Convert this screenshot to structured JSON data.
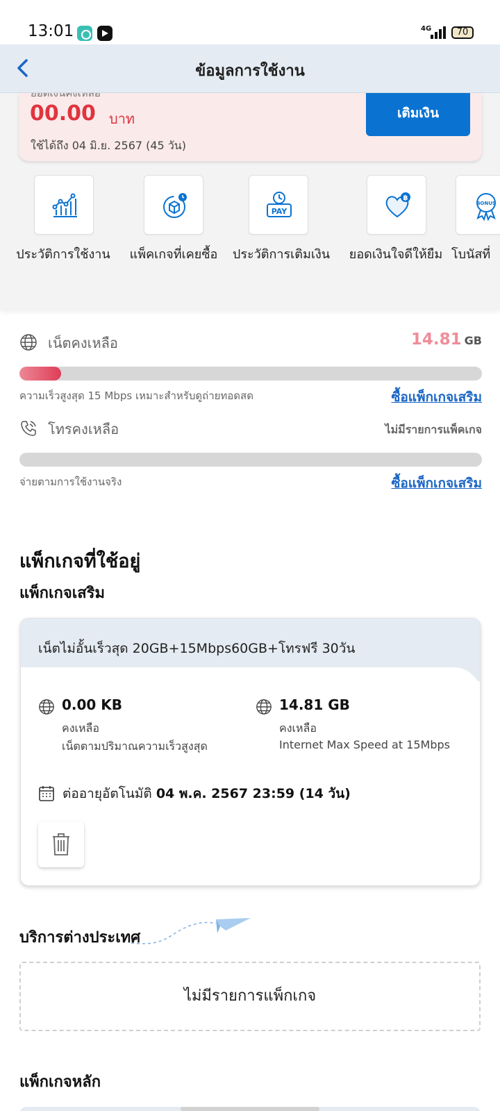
{
  "status_bar": {
    "time": "13:01",
    "network": "4G",
    "battery": "70"
  },
  "header": {
    "title": "ข้อมูลการใช้งาน",
    "back_icon": "chevron-left-icon"
  },
  "balance": {
    "label": "ยอดเงินคงเหลือ",
    "amount": "00.00",
    "unit": "บาท",
    "valid_prefix": "ใช้ได้ถึง",
    "valid_date": "04 มิ.ย. 2567 (45 วัน)",
    "topup_label": "เติมเงิน"
  },
  "menu": {
    "items": [
      {
        "label": "ประวัติการใช้งาน",
        "icon": "chart-icon"
      },
      {
        "label": "แพ็คเกจที่เคยซื้อ",
        "icon": "package-icon"
      },
      {
        "label": "ประวัติการเติมเงิน",
        "icon": "pay-icon"
      },
      {
        "label": "ยอดเงินใจดีให้ยืม",
        "icon": "heart-coin-icon"
      },
      {
        "label": "โบนัสที่",
        "icon": "bonus-icon"
      }
    ]
  },
  "usage": {
    "internet": {
      "title": "เน็ตคงเหลือ",
      "value": "14.81",
      "unit": "GB",
      "progress_fraction": 0.09,
      "note": "ความเร็วสูงสุด 15 Mbps เหมาะสำหรับดูถ่ายทอดสด",
      "link": "ซื้อแพ็กเกจเสริม"
    },
    "call": {
      "title": "โทรคงเหลือ",
      "status": "ไม่มีรายการแพ็คเกจ",
      "progress_fraction": 0,
      "note": "จ่ายตามการใช้งานจริง",
      "link": "ซื้อแพ็กเกจเสริม"
    }
  },
  "packages": {
    "title": "แพ็กเกจที่ใช้อยู่",
    "addon_title": "แพ็กเกจเสริม",
    "addon": {
      "name": "เน็ตไม่อั้นเร็วสุด 20GB+15Mbps60GB+โทรฟรี 30วัน",
      "quotas": [
        {
          "value": "0.00 KB",
          "label": "คงเหลือ",
          "desc": "เน็ตตามปริมาณความเร็วสูงสุด"
        },
        {
          "value": "14.81 GB",
          "label": "คงเหลือ",
          "desc": "Internet Max Speed at 15Mbps"
        }
      ],
      "renew_prefix": "ต่ออายุอัตโนมัติ",
      "renew_date": "04 พ.ค. 2567 23:59 (14 วัน)"
    },
    "international_title": "บริการต่างประเทศ",
    "international_empty": "ไม่มีรายการแพ็กเกจ",
    "main_title": "แพ็กเกจหลัก"
  },
  "colors": {
    "primary_blue": "#0a73d1",
    "balance_red": "#e0343f",
    "progress_red": "#df3d56",
    "header_bg": "#e4ebf2"
  }
}
